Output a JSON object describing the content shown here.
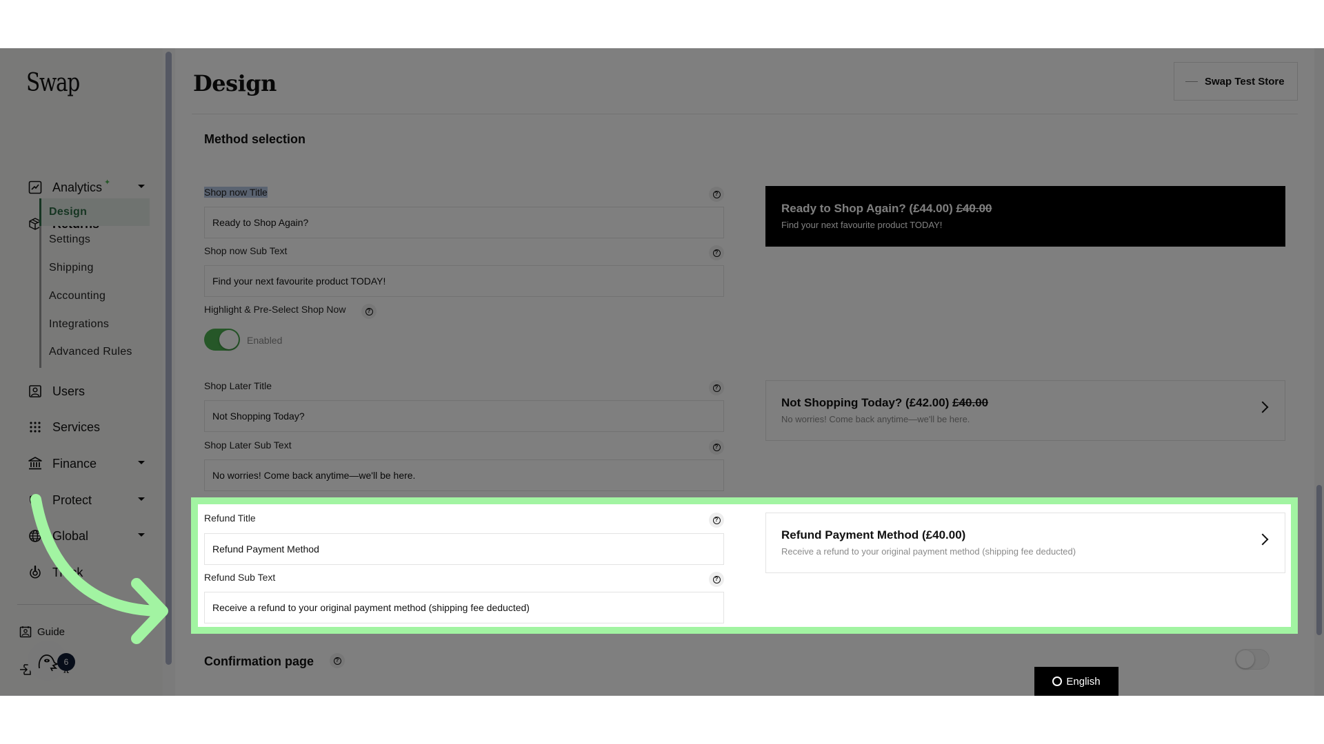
{
  "app": {
    "logo": "Swap"
  },
  "sidebar": {
    "items": [
      {
        "label": "Analytics",
        "icon": "chart-line-icon",
        "caret": "down",
        "badge_icon": "sparkle-icon"
      },
      {
        "label": "Returns",
        "icon": "box-icon",
        "caret": "up"
      },
      {
        "label": "Users",
        "icon": "user-card-icon"
      },
      {
        "label": "Services",
        "icon": "grid-dots-icon"
      },
      {
        "label": "Finance",
        "icon": "bank-icon",
        "caret": "down"
      },
      {
        "label": "Protect",
        "icon": "shield-icon",
        "caret": "down"
      },
      {
        "label": "Global",
        "icon": "globe-icon",
        "caret": "down"
      },
      {
        "label": "Track",
        "icon": "track-icon"
      }
    ],
    "returns_subitems": [
      {
        "label": "Design",
        "active": true
      },
      {
        "label": "Settings"
      },
      {
        "label": "Shipping"
      },
      {
        "label": "Accounting"
      },
      {
        "label": "Integrations"
      },
      {
        "label": "Advanced Rules"
      }
    ],
    "bottom_links": [
      {
        "label": "Guide",
        "icon": "guide-icon"
      },
      {
        "label": "Logout",
        "icon": "logout-icon"
      }
    ],
    "chat_badge_count": "6"
  },
  "header": {
    "title": "Design",
    "store_button": "Swap Test Store"
  },
  "method_selection": {
    "title": "Method selection",
    "shop_now_title": {
      "label": "Shop now Title",
      "value": "Ready to Shop Again?"
    },
    "shop_now_sub": {
      "label": "Shop now Sub Text",
      "value": "Find your next favourite product TODAY!"
    },
    "highlight": {
      "label": "Highlight & Pre-Select Shop Now",
      "state": "Enabled",
      "enabled": true
    },
    "shop_later_title": {
      "label": "Shop Later Title",
      "value": "Not Shopping Today?"
    },
    "shop_later_sub": {
      "label": "Shop Later Sub Text",
      "value": "No worries! Come back anytime—we'll be here."
    },
    "refund_title": {
      "label": "Refund Title",
      "value": "Refund Payment Method"
    },
    "refund_sub": {
      "label": "Refund Sub Text",
      "value": "Receive a refund to your original payment method (shipping fee deducted)"
    }
  },
  "previews": {
    "shop_now": {
      "title": "Ready to Shop Again? (£44.00)",
      "strike": "£40.00",
      "sub": "Find your next favourite product TODAY!"
    },
    "shop_later": {
      "title": "Not Shopping Today? (£42.00)",
      "strike": "£40.00",
      "sub": "No worries! Come back anytime—we'll be here."
    },
    "refund": {
      "title": "Refund Payment Method (£40.00)",
      "sub": "Receive a refund to your original payment method (shipping fee deducted)"
    }
  },
  "confirmation": {
    "title": "Confirmation page",
    "enabled": false
  },
  "language": {
    "label": "English"
  },
  "colors": {
    "accent": "#2c6a45",
    "toggle_on": "#4caf50",
    "highlight": "#a2f4a2"
  }
}
